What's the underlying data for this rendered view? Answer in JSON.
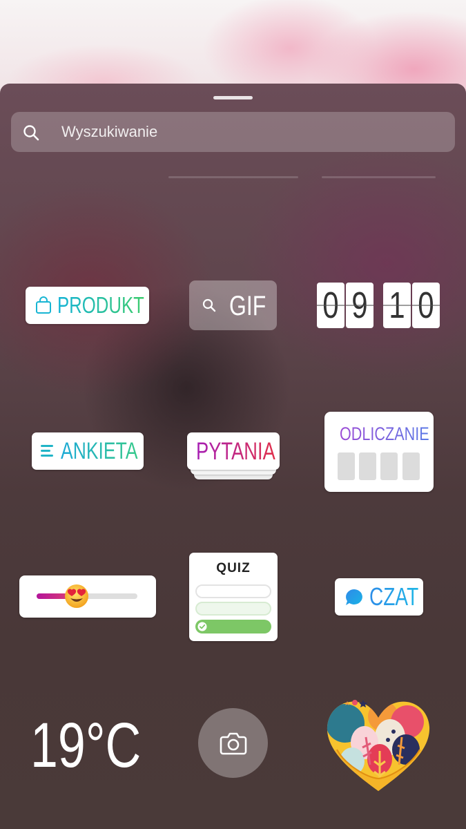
{
  "search": {
    "placeholder": "Wyszukiwanie"
  },
  "stickers": {
    "product": {
      "label": "PRODUKT"
    },
    "gif": {
      "label": "GIF"
    },
    "clock": {
      "digits": [
        "0",
        "9",
        "1",
        "0"
      ]
    },
    "poll": {
      "label": "ANKIETA"
    },
    "questions": {
      "label": "PYTANIA"
    },
    "countdown": {
      "label": "ODLICZANIE"
    },
    "emoji_slider": {
      "level_percent": 40
    },
    "quiz": {
      "label": "QUIZ"
    },
    "chat": {
      "label": "CZAT"
    },
    "temperature": {
      "value": "19°C"
    },
    "camera": {
      "icon": "camera-icon"
    },
    "heart": {
      "icon": "heart-illustration"
    }
  },
  "colors": {
    "product_gradient": [
      "#14b3d6",
      "#3ccc6d"
    ],
    "questions_gradient": [
      "#a61fb5",
      "#e0304b"
    ],
    "countdown_gradient": [
      "#9c4bd6",
      "#5b7ae6"
    ],
    "slider_fill": [
      "#b3149a",
      "#e24470"
    ],
    "quiz_correct": "#7dc766",
    "chat_gradient": [
      "#2c8de8",
      "#1fb6e6"
    ]
  }
}
